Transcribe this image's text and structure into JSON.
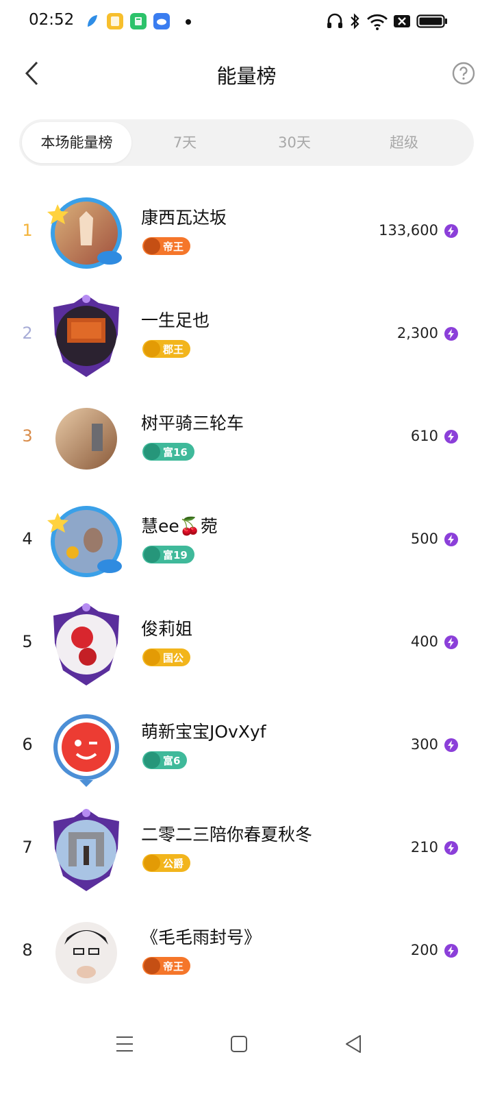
{
  "status_bar": {
    "time": "02:52",
    "left_icons": [
      "feather-icon",
      "notes-icon",
      "calculator-icon",
      "cloud-icon"
    ],
    "right_icons": [
      "headphones-icon",
      "bluetooth-icon",
      "wifi-icon",
      "data-off-icon",
      "battery-icon"
    ]
  },
  "header": {
    "title": "能量榜",
    "back_icon": "chevron-left-icon",
    "help_icon": "question-circle-icon"
  },
  "tabs": [
    {
      "label": "本场能量榜",
      "active": true
    },
    {
      "label": "7天",
      "active": false
    },
    {
      "label": "30天",
      "active": false
    },
    {
      "label": "超级",
      "active": false
    }
  ],
  "ranking": [
    {
      "rank": "1",
      "name": "康西瓦达坂",
      "badge": "帝王",
      "badge_color": "#f5762a",
      "score": "133,600"
    },
    {
      "rank": "2",
      "name": "一生足也",
      "badge": "郡王",
      "badge_color": "#f2b51c",
      "score": "2,300"
    },
    {
      "rank": "3",
      "name": "树平骑三轮车",
      "badge": "富16",
      "badge_color": "#3fb99a",
      "score": "610"
    },
    {
      "rank": "4",
      "name": "慧ee🍒菀",
      "badge": "富19",
      "badge_color": "#3fb99a",
      "score": "500"
    },
    {
      "rank": "5",
      "name": "俊莉姐",
      "badge": "国公",
      "badge_color": "#f2b51c",
      "score": "400"
    },
    {
      "rank": "6",
      "name": "萌新宝宝JOvXyf",
      "badge": "富6",
      "badge_color": "#3fb99a",
      "score": "300"
    },
    {
      "rank": "7",
      "name": "二零二三陪你春夏秋冬",
      "badge": "公爵",
      "badge_color": "#f2b51c",
      "score": "210"
    },
    {
      "rank": "8",
      "name": "《毛毛雨封号》",
      "badge": "帝王",
      "badge_color": "#f5762a",
      "score": "200"
    }
  ],
  "colors": {
    "energy_icon": "#8b3fd9",
    "rank1": "#f3b33a",
    "rank2": "#a7acd6",
    "rank3": "#d98c4a"
  },
  "navbar": {
    "icons": [
      "menu-icon",
      "home-square-icon",
      "back-triangle-icon"
    ]
  }
}
